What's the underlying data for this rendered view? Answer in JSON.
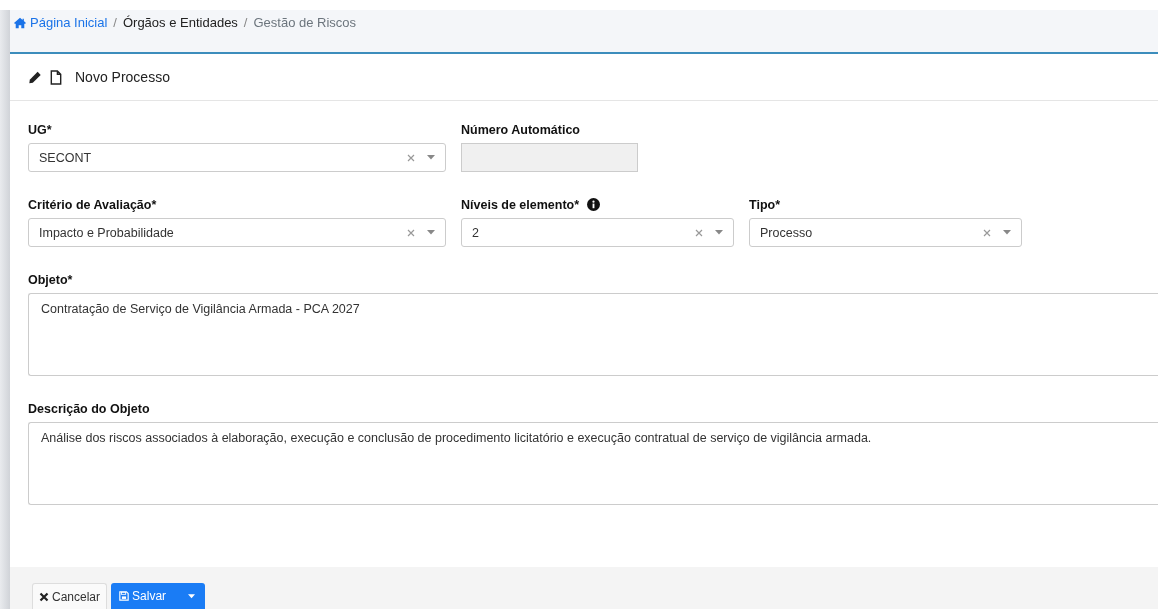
{
  "breadcrumb": [
    {
      "label": "Página Inicial",
      "kind": "home"
    },
    {
      "separator": "/",
      "label": "Órgãos e Entidades",
      "kind": "link"
    },
    {
      "separator": "/",
      "label": "Gestão de Riscos",
      "kind": "current"
    }
  ],
  "card": {
    "title": "Novo Processo"
  },
  "fields": [
    {
      "label": "UG*",
      "kind": "select",
      "value": "SECONT",
      "info": false
    },
    {
      "label": "Número Automático",
      "kind": "readonly",
      "info": false
    },
    {
      "label": "Critério de Avaliação*",
      "kind": "select",
      "value": "Impacto e Probabilidade",
      "info": false
    },
    {
      "label": "Níveis de elemento*",
      "kind": "select",
      "value": "2",
      "info": true
    },
    {
      "label": "Tipo*",
      "kind": "select",
      "value": "Processo",
      "info": false
    },
    {
      "label": "Objeto*",
      "kind": "textarea",
      "value": "Contratação de Serviço de Vigilância Armada - PCA 2027",
      "info": false
    },
    {
      "label": "Descrição do Objeto",
      "kind": "textarea",
      "value": "Análise dos riscos associados à elaboração, execução e conclusão de procedimento licitatório e execução contratual de serviço de vigilância armada.",
      "info": false
    }
  ],
  "buttons": [
    {
      "label": "Cancelar",
      "kind": "cancel"
    },
    {
      "label": "Salvar",
      "kind": "save"
    }
  ]
}
